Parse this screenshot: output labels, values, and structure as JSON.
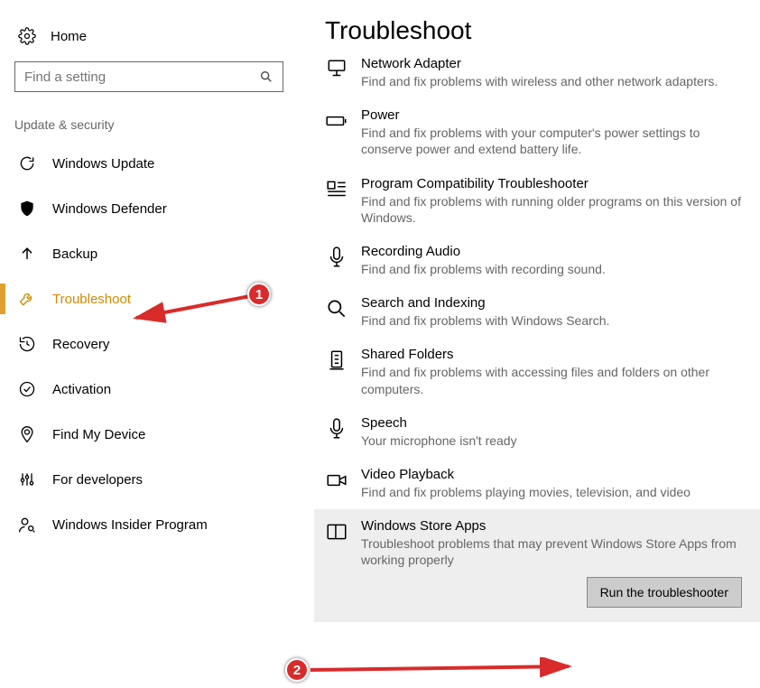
{
  "sidebar": {
    "home": "Home",
    "search_placeholder": "Find a setting",
    "section": "Update & security",
    "items": [
      {
        "label": "Windows Update"
      },
      {
        "label": "Windows Defender"
      },
      {
        "label": "Backup"
      },
      {
        "label": "Troubleshoot"
      },
      {
        "label": "Recovery"
      },
      {
        "label": "Activation"
      },
      {
        "label": "Find My Device"
      },
      {
        "label": "For developers"
      },
      {
        "label": "Windows Insider Program"
      }
    ]
  },
  "main": {
    "heading": "Troubleshoot",
    "items": [
      {
        "title": "Network Adapter",
        "desc": "Find and fix problems with wireless and other network adapters."
      },
      {
        "title": "Power",
        "desc": "Find and fix problems with your computer's power settings to conserve power and extend battery life."
      },
      {
        "title": "Program Compatibility Troubleshooter",
        "desc": "Find and fix problems with running older programs on this version of Windows."
      },
      {
        "title": "Recording Audio",
        "desc": "Find and fix problems with recording sound."
      },
      {
        "title": "Search and Indexing",
        "desc": "Find and fix problems with Windows Search."
      },
      {
        "title": "Shared Folders",
        "desc": "Find and fix problems with accessing files and folders on other computers."
      },
      {
        "title": "Speech",
        "desc": "Your microphone isn't ready"
      },
      {
        "title": "Video Playback",
        "desc": "Find and fix problems playing movies, television, and video"
      },
      {
        "title": "Windows Store Apps",
        "desc": "Troubleshoot problems that may prevent Windows Store Apps from working properly"
      }
    ],
    "run_button": "Run the troubleshooter"
  },
  "annotations": {
    "one": "1",
    "two": "2"
  }
}
